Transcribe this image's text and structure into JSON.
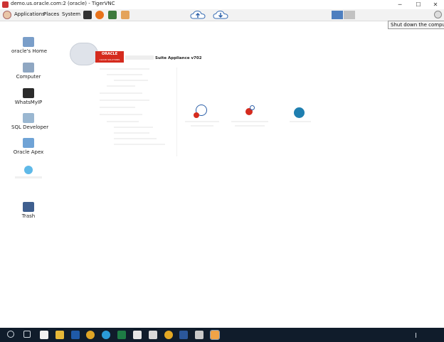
{
  "window": {
    "title": "demo.us.oracle.com:2 (oracle) - TigerVNC",
    "minimize": "─",
    "maximize": "☐",
    "close": "✕"
  },
  "menubar": {
    "items": [
      "Applications",
      "Places",
      "System"
    ]
  },
  "tooltip": "Shut down the computer",
  "desktop_icons": [
    {
      "label": "oracle's Home",
      "icon": "home-folder-icon"
    },
    {
      "label": "Computer",
      "icon": "computer-icon"
    },
    {
      "label": "WhatsMyIP",
      "icon": "terminal-icon"
    },
    {
      "label": "SQL Developer",
      "icon": "sql-developer-icon"
    },
    {
      "label": "Oracle Apex",
      "icon": "apex-icon"
    },
    {
      "label": "Trash",
      "icon": "trash-icon"
    }
  ],
  "app": {
    "brand": "ORACLE",
    "brand_sub": "CLOUD SOLUTIONS",
    "suite_label": "Suite Appliance v702"
  },
  "colors": {
    "taskbar": "#101c2b",
    "oracle_red": "#d52b1e",
    "link_teal": "#1f7fb0"
  }
}
